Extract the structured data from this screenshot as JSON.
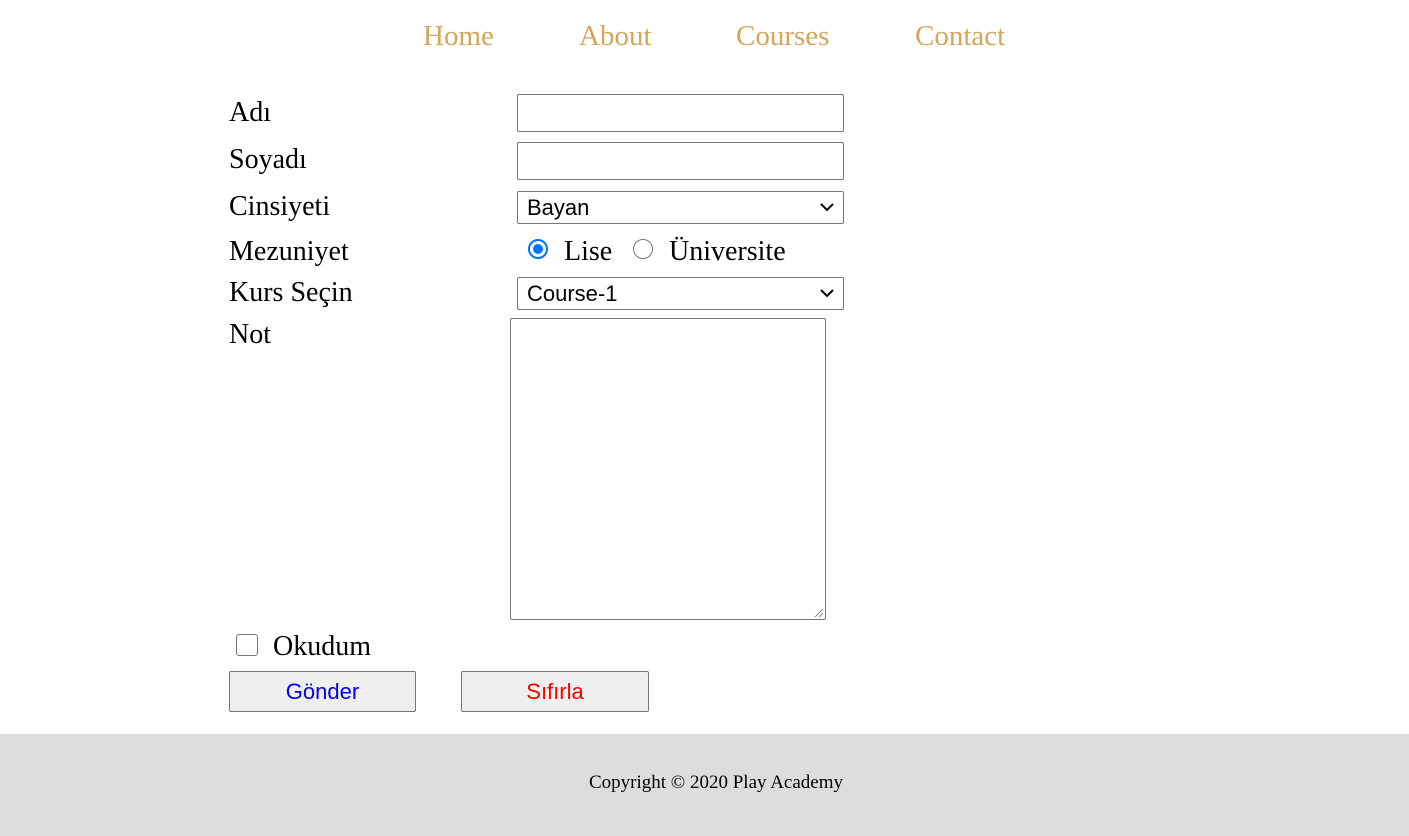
{
  "nav": {
    "items": [
      {
        "label": "Home"
      },
      {
        "label": "About"
      },
      {
        "label": "Courses"
      },
      {
        "label": "Contact"
      }
    ],
    "color": "#d4a55a"
  },
  "form": {
    "first_name": {
      "label": "Adı",
      "value": ""
    },
    "last_name": {
      "label": "Soyadı",
      "value": ""
    },
    "gender": {
      "label": "Cinsiyeti",
      "selected": "Bayan"
    },
    "graduation": {
      "label": "Mezuniyet",
      "options": [
        {
          "label": "Lise",
          "checked": true
        },
        {
          "label": "Üniversite",
          "checked": false
        }
      ]
    },
    "course": {
      "label": "Kurs Seçin",
      "selected": "Course-1"
    },
    "note": {
      "label": "Not",
      "value": ""
    },
    "agree": {
      "label": "Okudum",
      "checked": false
    },
    "submit_label": "Gönder",
    "reset_label": "Sıfırla"
  },
  "footer": {
    "copyright": "Copyright © 2020 Play Academy"
  },
  "colors": {
    "accent_radio": "#0075ff",
    "submit_text": "#0000ee",
    "reset_text": "#ff0000",
    "footer_bg": "#dddddd"
  }
}
